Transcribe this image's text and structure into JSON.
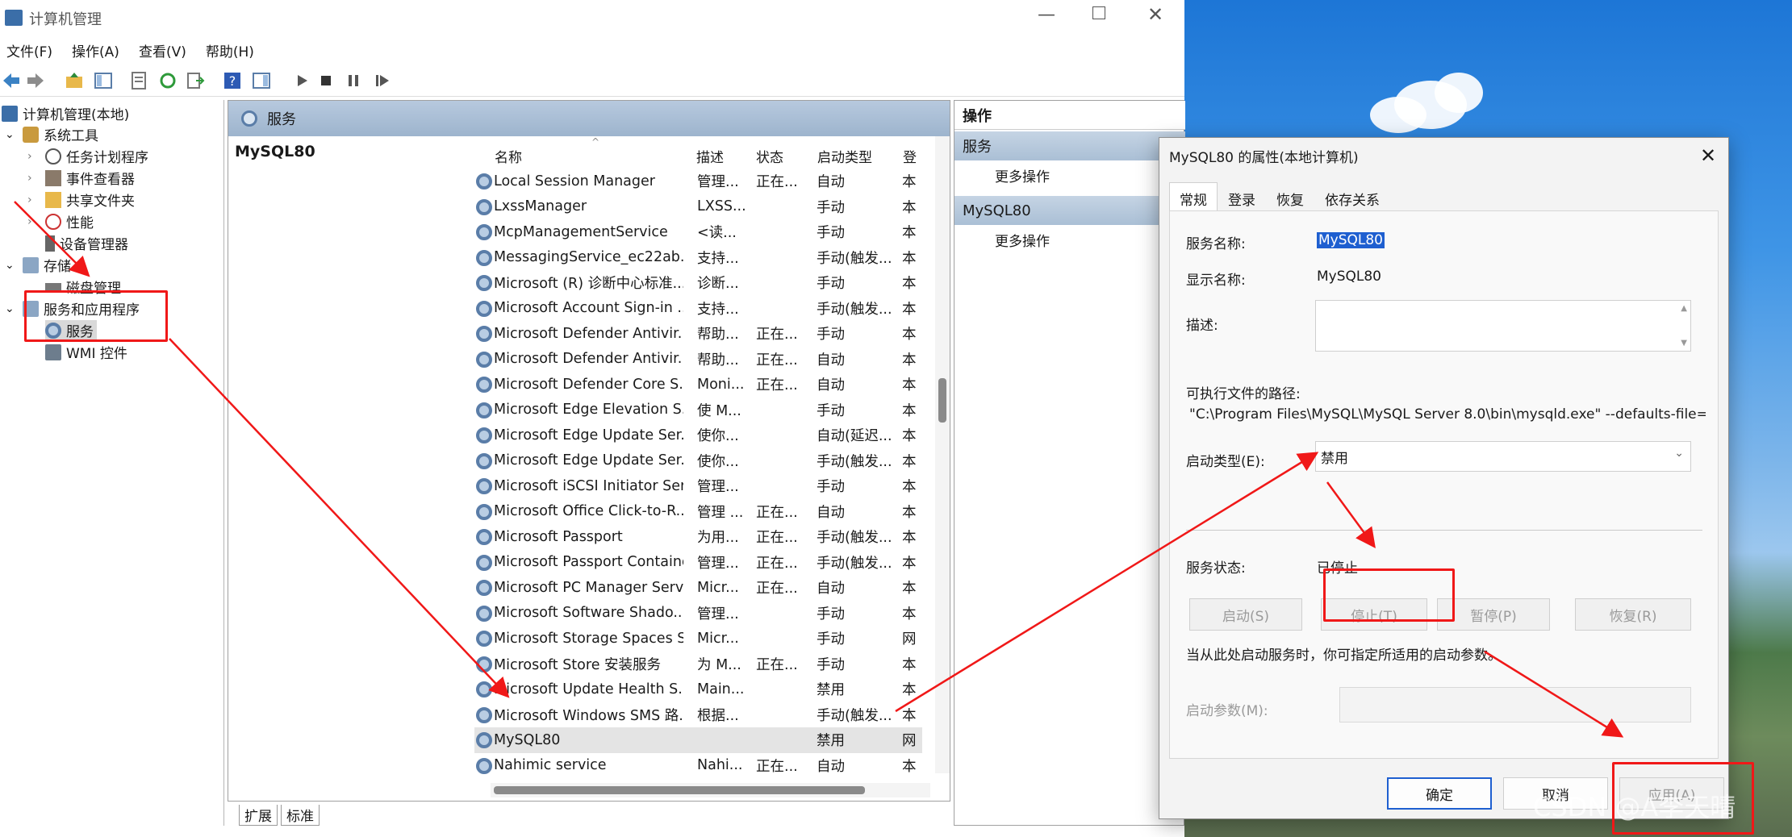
{
  "window": {
    "title": "计算机管理"
  },
  "menu": [
    "文件(F)",
    "操作(A)",
    "查看(V)",
    "帮助(H)"
  ],
  "tree": {
    "root": "计算机管理(本地)",
    "system_tools": "系统工具",
    "task_scheduler": "任务计划程序",
    "event_viewer": "事件查看器",
    "shared_folders": "共享文件夹",
    "performance": "性能",
    "device_manager": "设备管理器",
    "storage": "存储",
    "disk_management": "磁盘管理",
    "services_apps": "服务和应用程序",
    "services": "服务",
    "wmi": "WMI 控件"
  },
  "center": {
    "header": "服务",
    "selected_service": "MySQL80",
    "columns": [
      "名称",
      "描述",
      "状态",
      "启动类型",
      "登"
    ],
    "rows": [
      [
        "Local Session Manager",
        "管理...",
        "正在...",
        "自动",
        "本"
      ],
      [
        "LxssManager",
        "LXSS...",
        "",
        "手动",
        "本"
      ],
      [
        "McpManagementService",
        "<读...",
        "",
        "手动",
        "本"
      ],
      [
        "MessagingService_ec22ab...",
        "支持...",
        "",
        "手动(触发...",
        "本"
      ],
      [
        "Microsoft (R) 诊断中心标准...",
        "诊断...",
        "",
        "手动",
        "本"
      ],
      [
        "Microsoft Account Sign-in ...",
        "支持...",
        "",
        "手动(触发...",
        "本"
      ],
      [
        "Microsoft Defender Antivir...",
        "帮助...",
        "正在...",
        "手动",
        "本"
      ],
      [
        "Microsoft Defender Antivir...",
        "帮助...",
        "正在...",
        "自动",
        "本"
      ],
      [
        "Microsoft Defender Core S...",
        "Moni...",
        "正在...",
        "自动",
        "本"
      ],
      [
        "Microsoft Edge Elevation S...",
        "使 M...",
        "",
        "手动",
        "本"
      ],
      [
        "Microsoft Edge Update Ser...",
        "使你...",
        "",
        "自动(延迟...",
        "本"
      ],
      [
        "Microsoft Edge Update Ser...",
        "使你...",
        "",
        "手动(触发...",
        "本"
      ],
      [
        "Microsoft iSCSI Initiator Ser...",
        "管理...",
        "",
        "手动",
        "本"
      ],
      [
        "Microsoft Office Click-to-R...",
        "管理 ...",
        "正在...",
        "自动",
        "本"
      ],
      [
        "Microsoft Passport",
        "为用...",
        "正在...",
        "手动(触发...",
        "本"
      ],
      [
        "Microsoft Passport Container",
        "管理...",
        "正在...",
        "手动(触发...",
        "本"
      ],
      [
        "Microsoft PC Manager Serv...",
        "Micr...",
        "正在...",
        "自动",
        "本"
      ],
      [
        "Microsoft Software Shado...",
        "管理...",
        "",
        "手动",
        "本"
      ],
      [
        "Microsoft Storage Spaces S...",
        "Micr...",
        "",
        "手动",
        "网"
      ],
      [
        "Microsoft Store 安装服务",
        "为 M...",
        "正在...",
        "手动",
        "本"
      ],
      [
        "Microsoft Update Health S...",
        "Main...",
        "",
        "禁用",
        "本"
      ],
      [
        "Microsoft Windows SMS 路...",
        "根据...",
        "",
        "手动(触发...",
        "本"
      ],
      [
        "MySQL80",
        "",
        "",
        "禁用",
        "网"
      ],
      [
        "Nahimic service",
        "Nahi...",
        "正在...",
        "自动",
        "本"
      ]
    ],
    "tabs": [
      "扩展",
      "标准"
    ]
  },
  "actions": {
    "header": "操作",
    "section1": "服务",
    "more1": "更多操作",
    "section2": "MySQL80",
    "more2": "更多操作"
  },
  "dialog": {
    "title": "MySQL80 的属性(本地计算机)",
    "tabs": [
      "常规",
      "登录",
      "恢复",
      "依存关系"
    ],
    "service_name_label": "服务名称:",
    "service_name": "MySQL80",
    "display_name_label": "显示名称:",
    "display_name": "MySQL80",
    "desc_label": "描述:",
    "path_label": "可执行文件的路径:",
    "path": "\"C:\\Program Files\\MySQL\\MySQL Server 8.0\\bin\\mysqld.exe\" --defaults-file=",
    "startup_label": "启动类型(E):",
    "startup_value": "禁用",
    "status_label": "服务状态:",
    "status_value": "已停止",
    "btn_start": "启动(S)",
    "btn_stop": "停止(T)",
    "btn_pause": "暂停(P)",
    "btn_resume": "恢复(R)",
    "hint": "当从此处启动服务时，你可指定所适用的启动参数。",
    "params_label": "启动参数(M):",
    "ok": "确定",
    "cancel": "取消",
    "apply": "应用(A)"
  },
  "watermark": "CSDN @A李天晴"
}
